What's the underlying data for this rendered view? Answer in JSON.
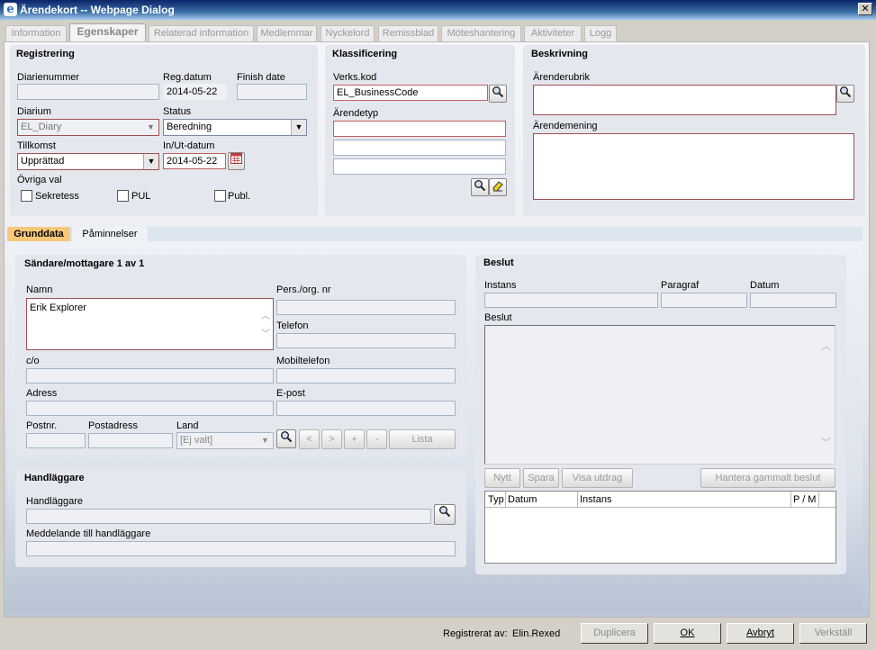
{
  "window": {
    "title": "Ärendekort -- Webpage Dialog",
    "close": "✕"
  },
  "tabs": [
    "Information",
    "Egenskaper",
    "Relaterad information",
    "Medlemmar",
    "Nyckelord",
    "Remissblad",
    "Möteshantering",
    "Aktiviteter",
    "Logg"
  ],
  "registrering": {
    "title": "Registrering",
    "diarienummer_label": "Diarienummer",
    "diarienummer": "",
    "regdatum_label": "Reg.datum",
    "regdatum": "2014-05-22",
    "finish_label": "Finish date",
    "finish": "",
    "diarium_label": "Diarium",
    "diarium": "EL_Diary",
    "status_label": "Status",
    "status": "Beredning",
    "tillkomst_label": "Tillkomst",
    "tillkomst": "Upprättad",
    "inut_label": "In/Ut-datum",
    "inut": "2014-05-22",
    "ovriga_label": "Övriga val",
    "sekretess": "Sekretess",
    "pul": "PUL",
    "publ": "Publ."
  },
  "klassificering": {
    "title": "Klassificering",
    "verkskod_label": "Verks.kod",
    "verkskod": "EL_BusinessCode",
    "arendetyp_label": "Ärendetyp"
  },
  "beskrivning": {
    "title": "Beskrivning",
    "rubrik_label": "Ärenderubrik",
    "mening_label": "Ärendemening"
  },
  "subtabs": [
    "Grunddata",
    "Påminnelser"
  ],
  "sandare": {
    "title": "Sändare/mottagare 1 av 1",
    "namn_label": "Namn",
    "namn": "Erik Explorer",
    "persorg_label": "Pers./org. nr",
    "telefon_label": "Telefon",
    "co_label": "c/o",
    "mobil_label": "Mobiltelefon",
    "adress_label": "Adress",
    "epost_label": "E-post",
    "postnr_label": "Postnr.",
    "postadress_label": "Postadress",
    "land_label": "Land",
    "land": "[Ej valt]",
    "nav": [
      "<",
      ">",
      "+",
      "-"
    ],
    "lista": "Lista"
  },
  "handlaggare": {
    "title": "Handläggare",
    "handlaggare_label": "Handläggare",
    "meddelande_label": "Meddelande till handläggare"
  },
  "beslut": {
    "title": "Beslut",
    "instans_label": "Instans",
    "paragraf_label": "Paragraf",
    "datum_label": "Datum",
    "beslut_label": "Beslut",
    "nytt": "Nytt",
    "spara": "Spara",
    "visa": "Visa utdrag",
    "hantera": "Hantera gammalt beslut",
    "columns": [
      "Typ",
      "Datum",
      "Instans",
      "P / M"
    ]
  },
  "footer": {
    "registrerat_label": "Registrerat av:",
    "registrerat": "Elin.Rexed",
    "duplicera": "Duplicera",
    "ok": "OK",
    "avbryt": "Avbryt",
    "verkstall": "Verkställ"
  },
  "icons": [
    "ie-icon",
    "search-icon",
    "eraser-icon",
    "calendar-icon",
    "chevron-down-icon"
  ]
}
